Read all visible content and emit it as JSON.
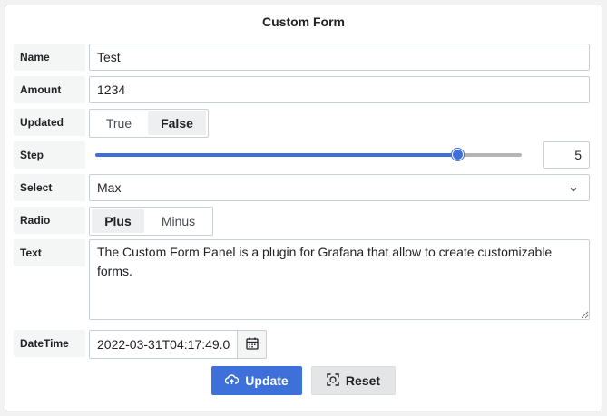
{
  "panel": {
    "title": "Custom Form"
  },
  "fields": {
    "name": {
      "label": "Name",
      "value": "Test"
    },
    "amount": {
      "label": "Amount",
      "value": "1234"
    },
    "updated": {
      "label": "Updated",
      "options": [
        "True",
        "False"
      ],
      "selected": "False"
    },
    "step": {
      "label": "Step",
      "value": "5",
      "level_fraction": 0.85
    },
    "select": {
      "label": "Select",
      "value": "Max"
    },
    "radio": {
      "label": "Radio",
      "options": [
        "Plus",
        "Minus"
      ],
      "selected": "Plus"
    },
    "text": {
      "label": "Text",
      "value": "The Custom Form Panel is a plugin for Grafana that allow to create customizable forms."
    },
    "datetime": {
      "label": "DateTime",
      "value": "2022-03-31T04:17:49.0"
    }
  },
  "buttons": {
    "update": "Update",
    "reset": "Reset"
  },
  "colors": {
    "primary": "#3d71d9",
    "label_bg": "#f4f5f5",
    "border": "#c7d0d9"
  },
  "icons": {
    "select": "chevron-down-icon",
    "datetime": "calendar-icon",
    "update": "cloud-upload-icon",
    "reset": "reset-icon"
  }
}
